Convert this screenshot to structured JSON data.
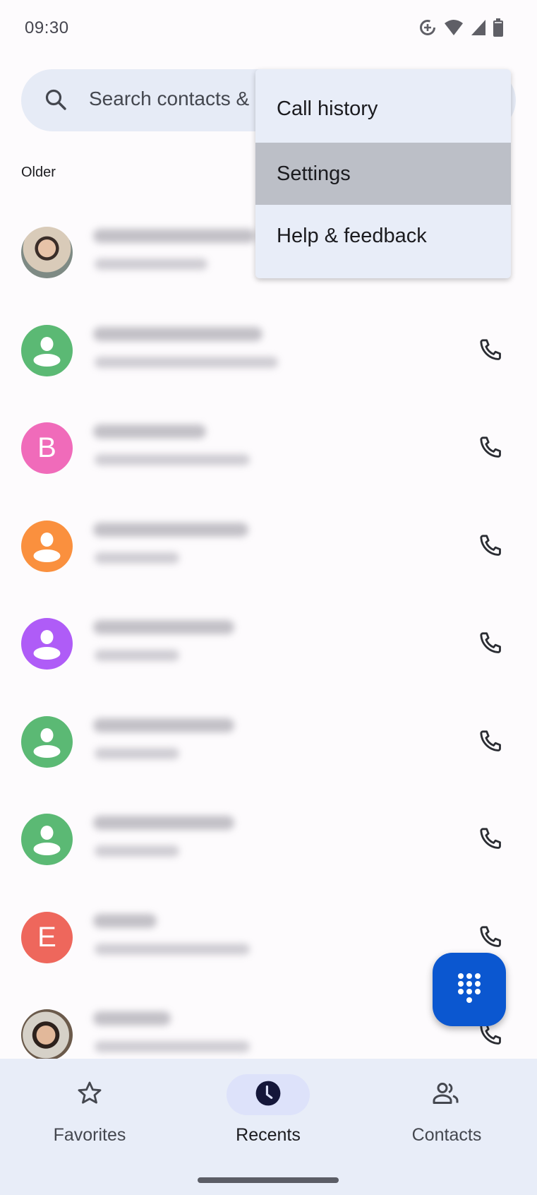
{
  "status_bar": {
    "time": "09:30",
    "icons": [
      "data-saver-icon",
      "wifi-icon",
      "cell-signal-icon",
      "battery-icon"
    ]
  },
  "search": {
    "placeholder": "Search contacts & places",
    "visible_text": "Search contacts &",
    "icon": "search-icon"
  },
  "section_header": "Older",
  "overflow_menu": {
    "items": [
      {
        "label": "Call history",
        "highlighted": false
      },
      {
        "label": "Settings",
        "highlighted": true
      },
      {
        "label": "Help & feedback",
        "highlighted": false
      }
    ]
  },
  "call_log": {
    "note": "contact names and call details are blurred in the screenshot",
    "rows": [
      {
        "avatar_type": "photo",
        "avatar_letter": "",
        "avatar_color": "#8a8f8c",
        "call_icon": true
      },
      {
        "avatar_type": "generic",
        "avatar_letter": "",
        "avatar_color": "#5bb974",
        "call_icon": true
      },
      {
        "avatar_type": "letter",
        "avatar_letter": "B",
        "avatar_color": "#f06bba",
        "call_icon": true
      },
      {
        "avatar_type": "generic",
        "avatar_letter": "",
        "avatar_color": "#fa903e",
        "call_icon": true
      },
      {
        "avatar_type": "generic",
        "avatar_letter": "",
        "avatar_color": "#af5cf7",
        "call_icon": true
      },
      {
        "avatar_type": "generic",
        "avatar_letter": "",
        "avatar_color": "#5bb974",
        "call_icon": true
      },
      {
        "avatar_type": "generic",
        "avatar_letter": "",
        "avatar_color": "#5bb974",
        "call_icon": true
      },
      {
        "avatar_type": "letter",
        "avatar_letter": "E",
        "avatar_color": "#ee675c",
        "call_icon": true
      },
      {
        "avatar_type": "photo",
        "avatar_letter": "",
        "avatar_color": "#6b5a4b",
        "call_icon": true
      }
    ]
  },
  "fab": {
    "icon": "dialpad-icon",
    "color": "#0b57d0"
  },
  "bottom_nav": {
    "items": [
      {
        "label": "Favorites",
        "icon": "star-icon",
        "active": false
      },
      {
        "label": "Recents",
        "icon": "clock-icon",
        "active": true
      },
      {
        "label": "Contacts",
        "icon": "people-icon",
        "active": false
      }
    ]
  }
}
